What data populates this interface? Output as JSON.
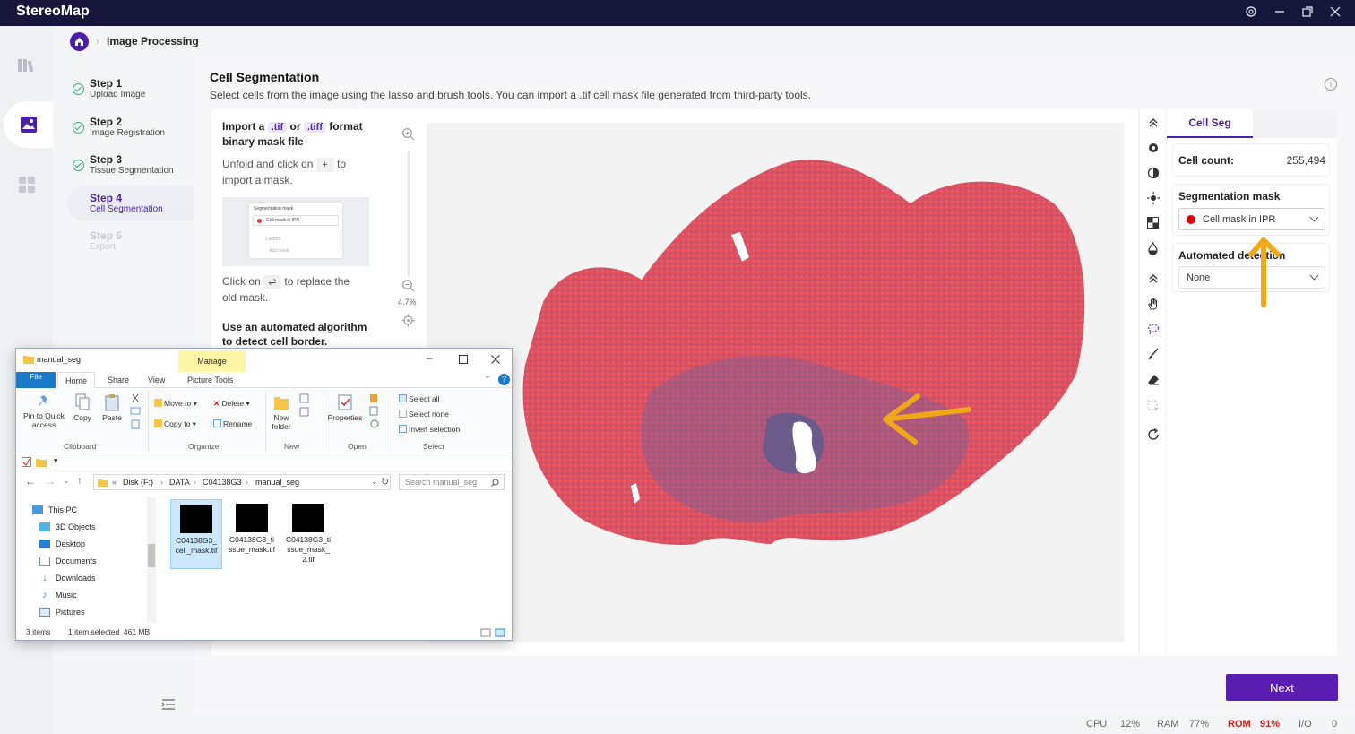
{
  "app": {
    "title": "StereoMap"
  },
  "window_controls": {
    "settings_icon": "gear-icon",
    "minimize_icon": "minimize-icon",
    "restore_icon": "restore-icon",
    "close_icon": "close-icon"
  },
  "breadcrumb": {
    "home_icon": "home-icon",
    "title": "Image Processing"
  },
  "steps": [
    {
      "title": "Step 1",
      "subtitle": "Upload Image",
      "state": "done"
    },
    {
      "title": "Step 2",
      "subtitle": "Image Registration",
      "state": "done"
    },
    {
      "title": "Step 3",
      "subtitle": "Tissue Segmentation",
      "state": "done"
    },
    {
      "title": "Step 4",
      "subtitle": "Cell Segmentation",
      "state": "active"
    },
    {
      "title": "Step 5",
      "subtitle": "Export",
      "state": "disabled"
    }
  ],
  "page": {
    "title": "Cell Segmentation",
    "description": "Select cells from the image using the lasso and brush tools. You can import a .tif cell mask file generated from third-party tools."
  },
  "guide": {
    "import_prefix": "Import a",
    "tif": ".tif",
    "or": "or",
    "tiff": ".tiff",
    "import_suffix": "format",
    "import_line2": "binary mask file",
    "unfold_a": "Unfold and click on",
    "plus": "+",
    "unfold_b": "to",
    "unfold_c": "import a mask.",
    "mini_title": "Segmentation mask",
    "mini_select": "Cell mask in IPR",
    "mini_custom": "Custom",
    "mini_add": "Add mask",
    "replace_a": "Click on",
    "swap": "⇌",
    "replace_b": "to replace the",
    "replace_c": "old mask.",
    "auto_line1": "Use an automated algorithm",
    "auto_line2": "to detect cell border."
  },
  "zoom": {
    "level": "4.7%"
  },
  "panel": {
    "tab": "Cell Seg",
    "cell_count_label": "Cell count:",
    "cell_count_value": "255,494",
    "seg_mask_label": "Segmentation mask",
    "seg_mask_value": "Cell mask in IPR",
    "auto_label": "Automated detection",
    "auto_value": "None"
  },
  "buttons": {
    "next": "Next"
  },
  "status": {
    "cpu_label": "CPU",
    "cpu_value": "12%",
    "ram_label": "RAM",
    "ram_value": "77%",
    "rom_label": "ROM",
    "rom_value": "91%",
    "io_label": "I/O",
    "io_value": "0"
  },
  "explorer": {
    "title": "manual_seg",
    "contextual_tab": "Manage",
    "tabs": [
      "File",
      "Home",
      "Share",
      "View",
      "Picture Tools"
    ],
    "ribbon": {
      "pin": "Pin to Quick access",
      "copy": "Copy",
      "paste": "Paste",
      "clipboard": "Clipboard",
      "move_to": "Move to",
      "copy_to": "Copy to",
      "delete": "Delete",
      "rename": "Rename",
      "organize": "Organize",
      "new_folder": "New folder",
      "new": "New",
      "properties": "Properties",
      "open": "Open",
      "select_all": "Select all",
      "select_none": "Select none",
      "invert_selection": "Invert selection",
      "select": "Select"
    },
    "path": [
      "«",
      "Disk (F:)",
      "DATA",
      "C04138G3",
      "manual_seg"
    ],
    "search_placeholder": "Search manual_seg",
    "nav": [
      "This PC",
      "3D Objects",
      "Desktop",
      "Documents",
      "Downloads",
      "Music",
      "Pictures"
    ],
    "files": [
      {
        "name": "C04138G3_cell_mask.tif",
        "selected": true
      },
      {
        "name": "C04138G3_tissue_mask.tif",
        "selected": false
      },
      {
        "name": "C04138G3_tissue_mask_2.tif",
        "selected": false
      }
    ],
    "status_items": "3 items",
    "status_selected": "1 item selected  461 MB"
  },
  "colors": {
    "accent": "#5a1db2",
    "titlebar": "#16163a",
    "tissue": "#e2505e",
    "annotation_arrow": "#f0a81a",
    "warning": "#d81b1b"
  }
}
